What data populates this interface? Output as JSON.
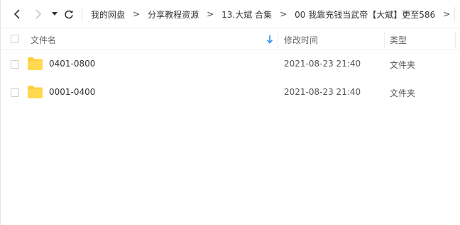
{
  "breadcrumb": {
    "items": [
      "我的网盘",
      "分享教程资源",
      "13.大斌 合集",
      "00 我靠充钱当武帝【大斌】更至586"
    ],
    "trailing_chevron": ">"
  },
  "columns": {
    "name": "文件名",
    "modified": "修改时间",
    "type": "类型"
  },
  "files": [
    {
      "name": "0401-0800",
      "modified": "2021-08-23 21:40",
      "type": "文件夹",
      "icon": "folder-icon"
    },
    {
      "name": "0001-0400",
      "modified": "2021-08-23 21:40",
      "type": "文件夹",
      "icon": "folder-icon"
    }
  ],
  "colors": {
    "folder": "#ffcf3f",
    "sort_arrow": "#2f8cf0",
    "disabled_nav": "#c8c8c8"
  }
}
